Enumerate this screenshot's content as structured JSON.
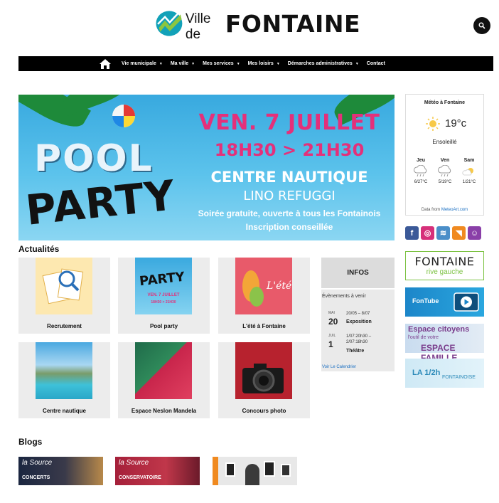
{
  "header": {
    "logo_small": "Ville de",
    "logo_big": "FONTAINE"
  },
  "nav": {
    "items": [
      "Vie municipale",
      "Ma ville",
      "Mes services",
      "Mes loisirs",
      "Démarches administratives",
      "Contact"
    ]
  },
  "hero": {
    "word1": "POOL",
    "word2": "PARTY",
    "date": "VEN. 7 JUILLET",
    "time": "18H30 > 21H30",
    "place1": "CENTRE NAUTIQUE",
    "place2": "LINO REFUGGI",
    "sub1": "Soirée gratuite, ouverte à tous les Fontainois",
    "sub2": "Inscription conseillée"
  },
  "weather": {
    "title": "Météo à Fontaine",
    "temp": "19°c",
    "condition": "Ensoleillé",
    "days": [
      {
        "name": "Jeu",
        "range": "6/27°C",
        "icon": "cloud-rain-icon"
      },
      {
        "name": "Ven",
        "range": "5/19°C",
        "icon": "cloud-rain-icon"
      },
      {
        "name": "Sam",
        "range": "1/21°C",
        "icon": "sun-cloud-icon"
      }
    ],
    "source_prefix": "Data from",
    "source_link": "MeteoArt.com"
  },
  "social": [
    {
      "icon": "facebook-icon",
      "glyph": "f",
      "color": "#3b5998"
    },
    {
      "icon": "instagram-icon",
      "glyph": "◎",
      "color": "#d6307a"
    },
    {
      "icon": "layers-icon",
      "glyph": "≋",
      "color": "#4a8ec8"
    },
    {
      "icon": "rss-icon",
      "glyph": "◥",
      "color": "#f08a20"
    },
    {
      "icon": "people-icon",
      "glyph": "☺",
      "color": "#8a3fa8"
    }
  ],
  "side_banners": {
    "b1_title": "FONTAINE",
    "b1_sub": "rive gauche",
    "b2_title": "FonTube",
    "b3_l1": "Espace citoyens",
    "b3_l2": "l'outil de votre",
    "b3_l3": "ESPACE FAMILLE",
    "b4_title": "LA 1/2h",
    "b4_sub": "FONTAINOISE"
  },
  "actualites": {
    "title": "Actualités",
    "cards": [
      {
        "label": "Recrutement"
      },
      {
        "label": "Pool party"
      },
      {
        "label": "L'été à Fontaine"
      },
      {
        "label": "Centre nautique"
      },
      {
        "label": "Espace Neslon Mandela"
      },
      {
        "label": "Concours photo"
      }
    ]
  },
  "infos": {
    "title": "INFOS",
    "subtitle": "Évènements à venir",
    "events": [
      {
        "month": "MAI",
        "day": "20",
        "dates": "20/05 – 8/07",
        "name": "Exposition"
      },
      {
        "month": "JUIL",
        "day": "1",
        "dates": "1/07:20h30 – 2/07:18h30",
        "name": "Théâtre"
      }
    ],
    "calendar_link": "Voir Le Calendrier"
  },
  "blogs": {
    "title": "Blogs",
    "items": [
      {
        "l1": "la Source",
        "l2": "CONCERTS"
      },
      {
        "l1": "la Source",
        "l2": "CONSERVATOIRE"
      },
      {
        "l1": "",
        "l2": ""
      }
    ]
  }
}
